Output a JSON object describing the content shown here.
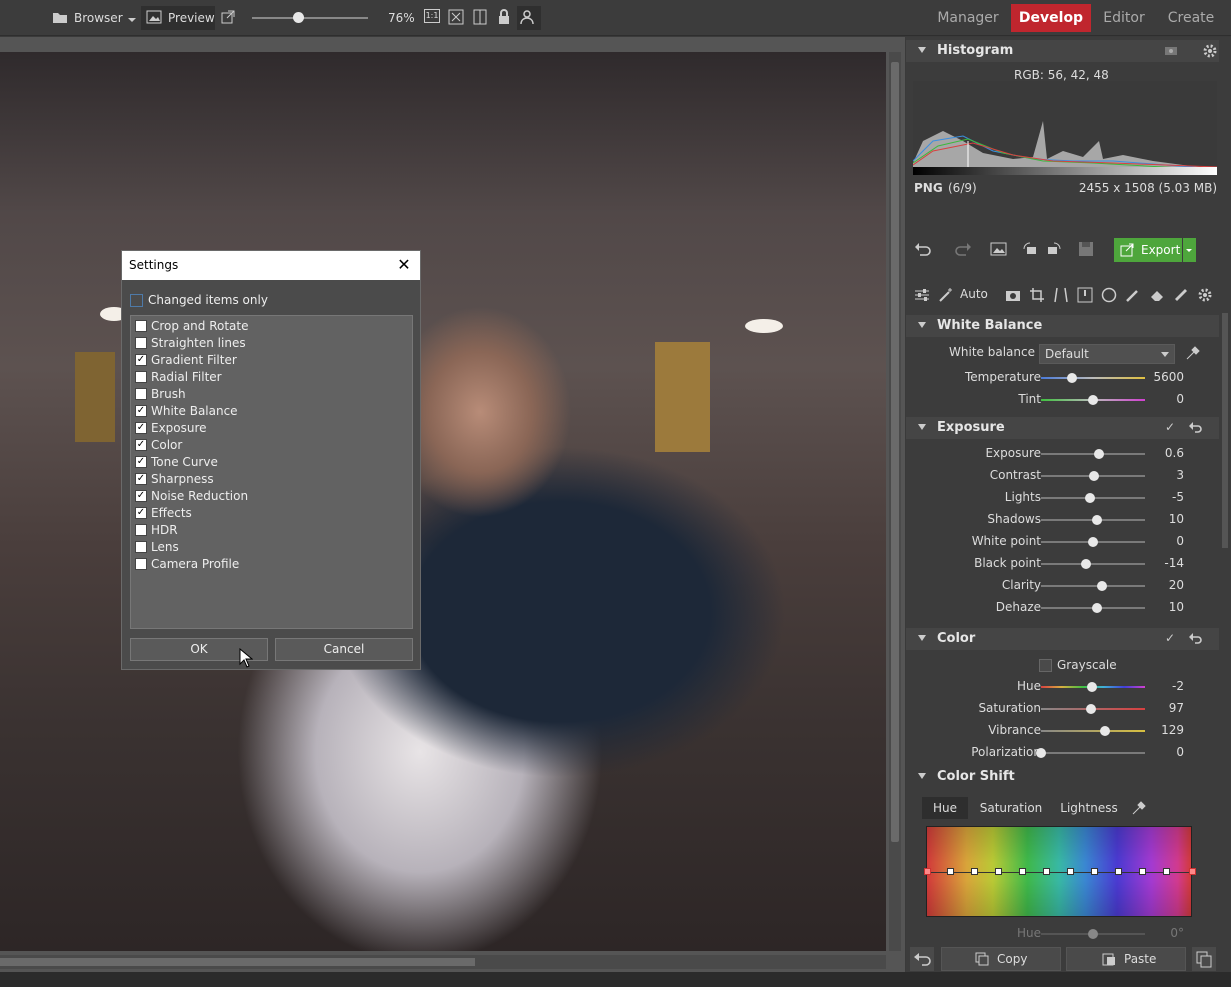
{
  "topbar": {
    "browser_label": "Browser",
    "preview_label": "Preview",
    "zoom": "76%",
    "one_to_one": "1:1",
    "zoom_level": 0.4
  },
  "modes": {
    "manager": "Manager",
    "develop": "Develop",
    "editor": "Editor",
    "create": "Create"
  },
  "accent_color": "#c0262e",
  "histogram": {
    "title": "Histogram",
    "rgb_readout": "RGB: 56, 42, 48",
    "format": "PNG",
    "index": "(6/9)",
    "dimensions": "2455 x 1508 (5.03 MB)"
  },
  "toolbar": {
    "export_label": "Export",
    "auto_label": "Auto"
  },
  "white_balance": {
    "title": "White Balance",
    "wb_label": "White balance",
    "wb_value": "Default",
    "rows": [
      {
        "label": "Temperature",
        "value": "5600",
        "pos": 0.3
      },
      {
        "label": "Tint",
        "value": "0",
        "pos": 0.5
      }
    ]
  },
  "exposure": {
    "title": "Exposure",
    "rows": [
      {
        "label": "Exposure",
        "value": "0.6",
        "pos": 0.56
      },
      {
        "label": "Contrast",
        "value": "3",
        "pos": 0.51
      },
      {
        "label": "Lights",
        "value": "-5",
        "pos": 0.47
      },
      {
        "label": "Shadows",
        "value": "10",
        "pos": 0.54
      },
      {
        "label": "White point",
        "value": "0",
        "pos": 0.5
      },
      {
        "label": "Black point",
        "value": "-14",
        "pos": 0.43
      },
      {
        "label": "Clarity",
        "value": "20",
        "pos": 0.59
      },
      {
        "label": "Dehaze",
        "value": "10",
        "pos": 0.54
      }
    ]
  },
  "color": {
    "title": "Color",
    "grayscale_label": "Grayscale",
    "rows": [
      {
        "label": "Hue",
        "value": "-2",
        "pos": 0.49
      },
      {
        "label": "Saturation",
        "value": "97",
        "pos": 0.48
      },
      {
        "label": "Vibrance",
        "value": "129",
        "pos": 0.62
      },
      {
        "label": "Polarization",
        "value": "0",
        "pos": 0.0
      }
    ]
  },
  "color_shift": {
    "title": "Color Shift",
    "tabs": [
      "Hue",
      "Saturation",
      "Lightness"
    ],
    "bottom_label": "Hue",
    "bottom_value": "0°"
  },
  "bottom_buttons": {
    "copy": "Copy",
    "paste": "Paste"
  },
  "dialog": {
    "title": "Settings",
    "changed_only": "Changed items only",
    "items": [
      {
        "label": "Crop and Rotate",
        "checked": false
      },
      {
        "label": "Straighten lines",
        "checked": false
      },
      {
        "label": "Gradient Filter",
        "checked": true
      },
      {
        "label": "Radial Filter",
        "checked": false
      },
      {
        "label": "Brush",
        "checked": false
      },
      {
        "label": "White Balance",
        "checked": true
      },
      {
        "label": "Exposure",
        "checked": true
      },
      {
        "label": "Color",
        "checked": true
      },
      {
        "label": "Tone Curve",
        "checked": true
      },
      {
        "label": "Sharpness",
        "checked": true
      },
      {
        "label": "Noise Reduction",
        "checked": true
      },
      {
        "label": "Effects",
        "checked": true
      },
      {
        "label": "HDR",
        "checked": false
      },
      {
        "label": "Lens",
        "checked": false
      },
      {
        "label": "Camera Profile",
        "checked": false
      }
    ],
    "ok": "OK",
    "cancel": "Cancel"
  }
}
